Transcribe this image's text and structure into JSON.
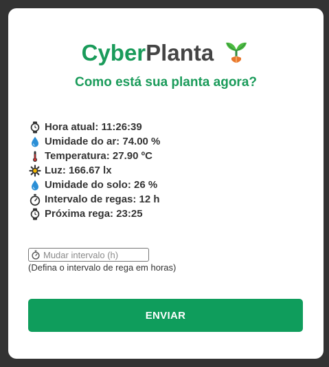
{
  "brand": {
    "part1": "Cyber",
    "part2": "Planta",
    "icon": "seedling-icon"
  },
  "subtitle": "Como está sua planta agora?",
  "readings": [
    {
      "icon": "watch-icon",
      "text": "Hora atual: 11:26:39"
    },
    {
      "icon": "droplet-icon",
      "text": "Umidade do ar: 74.00 %"
    },
    {
      "icon": "thermometer-icon",
      "text": "Temperatura: 27.90 ºC"
    },
    {
      "icon": "sun-icon",
      "text": "Luz: 166.67 lx"
    },
    {
      "icon": "droplet-icon",
      "text": "Umidade do solo: 26 %"
    },
    {
      "icon": "stopwatch-icon",
      "text": "Intervalo de regas: 12 h"
    },
    {
      "icon": "watch-icon",
      "text": "Próxima rega: 23:25"
    }
  ],
  "form": {
    "placeholder": "Mudar intervalo (h)",
    "value": "",
    "hint": "(Defina o intervalo de rega em horas)",
    "button_label": "ENVIAR"
  },
  "colors": {
    "brand_green": "#1a9b5a",
    "button_green": "#0f9d5c",
    "text_dark": "#333333",
    "page_background": "#333333",
    "card_background": "#ffffff"
  }
}
